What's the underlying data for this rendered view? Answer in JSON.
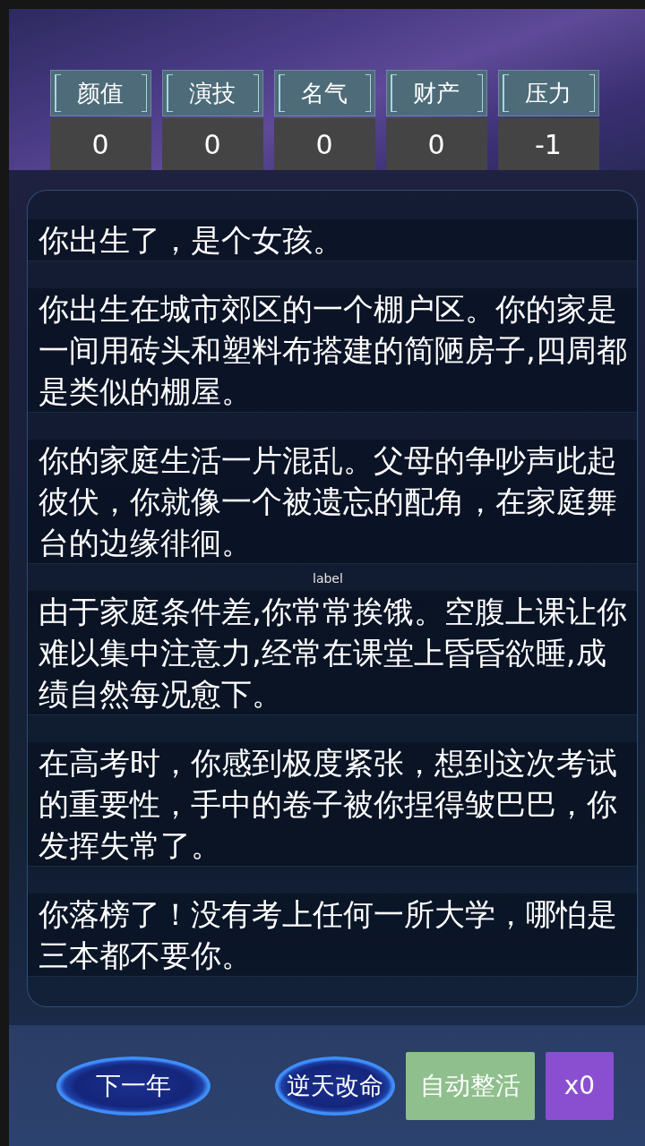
{
  "stats": [
    {
      "label": "颜值",
      "value": "0"
    },
    {
      "label": "演技",
      "value": "0"
    },
    {
      "label": "名气",
      "value": "0"
    },
    {
      "label": "财产",
      "value": "0"
    },
    {
      "label": "压力",
      "value": "-1"
    }
  ],
  "story": [
    {
      "text": "你出生了，是个女孩。"
    },
    {
      "text": "你出生在城市郊区的一个棚户区。你的家是一间用砖头和塑料布搭建的简陋房子,四周都是类似的棚屋。"
    },
    {
      "text": "你的家庭生活一片混乱。父母的争吵声此起彼伏，你就像一个被遗忘的配角，在家庭舞台的边缘徘徊。"
    },
    {
      "text": "由于家庭条件差,你常常挨饿。空腹上课让你难以集中注意力,经常在课堂上昏昏欲睡,成绩自然每况愈下。",
      "floating_label": "label"
    },
    {
      "text": "在高考时，你感到极度紧张，想到这次考试的重要性，手中的卷子被你捏得皱巴巴，你发挥失常了。"
    },
    {
      "text": "你落榜了！没有考上任何一所大学，哪怕是三本都不要你。"
    }
  ],
  "actions": [
    {
      "label": "下一年",
      "kind": "wide_orb"
    },
    {
      "label": "逆天改命",
      "kind": "orb"
    },
    {
      "label": "自动整活",
      "kind": "flat",
      "color": "#8fbf8d"
    },
    {
      "label": "x0",
      "kind": "flat",
      "color": "#8a4fd0"
    }
  ]
}
